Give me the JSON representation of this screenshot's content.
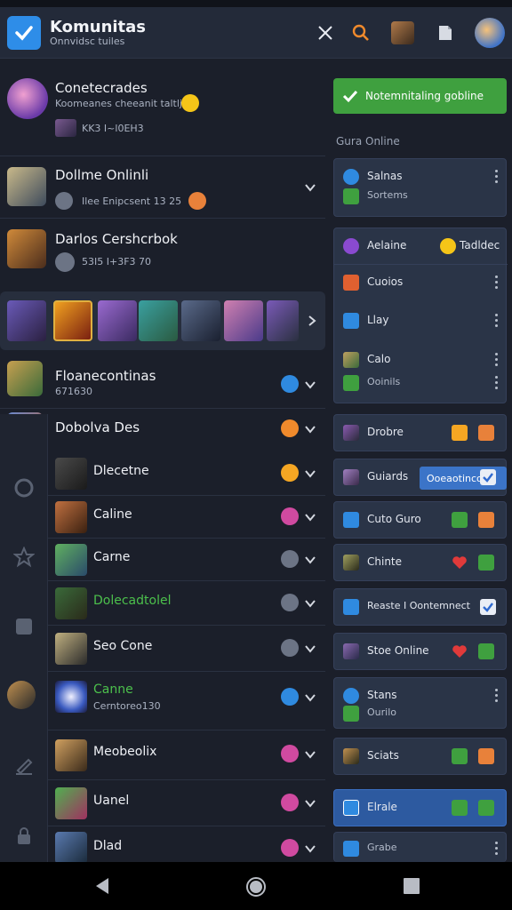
{
  "app": {
    "title": "Komunitas",
    "subtitle": "Onnvidsc tuiles"
  },
  "toolbar": {
    "close_label": "close",
    "search_label": "search"
  },
  "friends": [
    {
      "name": "Conetecrades",
      "sub": "Koomeanes cheeanit taltljc",
      "meta": "KK3 I~l0EH3"
    },
    {
      "name": "Dollme Onlinli",
      "sub": "Ilee Enipcsent 13 25"
    },
    {
      "name": "Darlos Cershcrbok",
      "sub": "53I5 I+3F3 70"
    }
  ],
  "groups": [
    {
      "name": "Floanecontinas",
      "sub": "671630"
    },
    {
      "name": "Dobolva Des"
    }
  ],
  "subs": [
    {
      "name": "Dlecetne"
    },
    {
      "name": "Caline"
    },
    {
      "name": "Carne"
    },
    {
      "name": "Dolecadtolel"
    },
    {
      "name": "Seo Cone"
    },
    {
      "name": "Canne",
      "sub": "Cerntoreo130"
    },
    {
      "name": "Meobeolix"
    },
    {
      "name": "Uanel"
    },
    {
      "name": "Dlad"
    }
  ],
  "right": {
    "notify_label": "Notemnitaling gobline",
    "section_label": "Gura Online",
    "card1": {
      "a": "Salnas",
      "b": "Sortems"
    },
    "card2": {
      "a": "Aelaine",
      "b": "Tadldec",
      "c": "Cuoios",
      "d": "Llay",
      "e": "Calo",
      "f": "Ooinils"
    },
    "row_obsre": "Drobre",
    "row_guiards": "Guiards",
    "row_pill": "Ooeaotinco",
    "row_cure": "Cuto Guro",
    "row_chinte": "Chinte",
    "row_reaste": "Reaste I Oontemnect",
    "row_stoe": "Stoe Online",
    "card3": {
      "a": "Stans",
      "b": "Ourilo"
    },
    "row_sciats": "Sciats",
    "row_elrale": "Elrale",
    "row_grabe": "Grabe"
  },
  "colors": {
    "accent": "#2e8de8",
    "online": "#3fa03f",
    "bg": "#1b1f2a",
    "card": "#2a3447"
  }
}
